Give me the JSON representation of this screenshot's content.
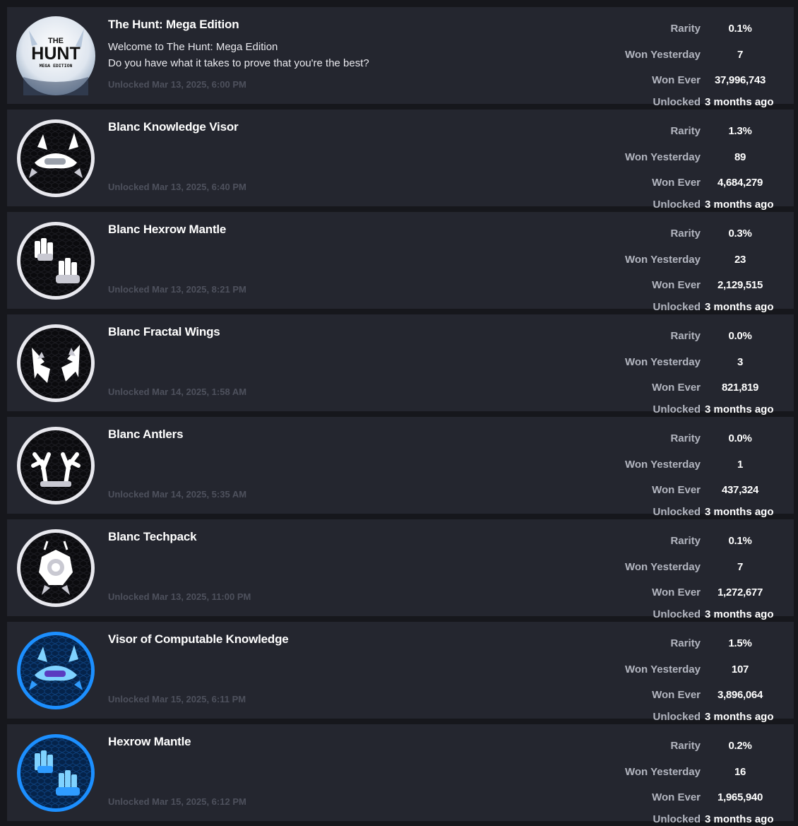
{
  "labels": {
    "rarity": "Rarity",
    "won_yesterday": "Won Yesterday",
    "won_ever": "Won Ever",
    "unlocked": "Unlocked"
  },
  "badge_text": {
    "the": "THE",
    "hunt": "HUNT",
    "edition": "MEGA EDITION"
  },
  "achievements": [
    {
      "title": "The Hunt: Mega Edition",
      "description_lines": [
        "Welcome to The Hunt: Mega Edition",
        "Do you have what it takes to prove that you're the best?"
      ],
      "unlocked_date": "Unlocked Mar 13, 2025, 6:00 PM",
      "rarity": "0.1%",
      "won_yesterday": "7",
      "won_ever": "37,996,743",
      "unlocked_ago": "3 months ago",
      "icon": "hunt-logo-icon",
      "theme": "logo"
    },
    {
      "title": "Blanc Knowledge Visor",
      "description_lines": [],
      "unlocked_date": "Unlocked Mar 13, 2025, 6:40 PM",
      "rarity": "1.3%",
      "won_yesterday": "89",
      "won_ever": "4,684,279",
      "unlocked_ago": "3 months ago",
      "icon": "visor-icon",
      "theme": "blanc"
    },
    {
      "title": "Blanc Hexrow Mantle",
      "description_lines": [],
      "unlocked_date": "Unlocked Mar 13, 2025, 8:21 PM",
      "rarity": "0.3%",
      "won_yesterday": "23",
      "won_ever": "2,129,515",
      "unlocked_ago": "3 months ago",
      "icon": "mantle-icon",
      "theme": "blanc"
    },
    {
      "title": "Blanc Fractal Wings",
      "description_lines": [],
      "unlocked_date": "Unlocked Mar 14, 2025, 1:58 AM",
      "rarity": "0.0%",
      "won_yesterday": "3",
      "won_ever": "821,819",
      "unlocked_ago": "3 months ago",
      "icon": "wings-icon",
      "theme": "blanc"
    },
    {
      "title": "Blanc Antlers",
      "description_lines": [],
      "unlocked_date": "Unlocked Mar 14, 2025, 5:35 AM",
      "rarity": "0.0%",
      "won_yesterday": "1",
      "won_ever": "437,324",
      "unlocked_ago": "3 months ago",
      "icon": "antlers-icon",
      "theme": "blanc"
    },
    {
      "title": "Blanc Techpack",
      "description_lines": [],
      "unlocked_date": "Unlocked Mar 13, 2025, 11:00 PM",
      "rarity": "0.1%",
      "won_yesterday": "7",
      "won_ever": "1,272,677",
      "unlocked_ago": "3 months ago",
      "icon": "techpack-icon",
      "theme": "blanc"
    },
    {
      "title": "Visor of Computable Knowledge",
      "description_lines": [],
      "unlocked_date": "Unlocked Mar 15, 2025, 6:11 PM",
      "rarity": "1.5%",
      "won_yesterday": "107",
      "won_ever": "3,896,064",
      "unlocked_ago": "3 months ago",
      "icon": "visor-icon",
      "theme": "blue"
    },
    {
      "title": "Hexrow Mantle",
      "description_lines": [],
      "unlocked_date": "Unlocked Mar 15, 2025, 6:12 PM",
      "rarity": "0.2%",
      "won_yesterday": "16",
      "won_ever": "1,965,940",
      "unlocked_ago": "3 months ago",
      "icon": "mantle-icon",
      "theme": "blue"
    }
  ],
  "colors": {
    "page_bg": "#16171c",
    "row_bg": "#24262f",
    "label": "#b3b6c0",
    "date": "#4e515d",
    "blanc_ring": "#e8e8ee",
    "blue_ring": "#1c8fff"
  }
}
